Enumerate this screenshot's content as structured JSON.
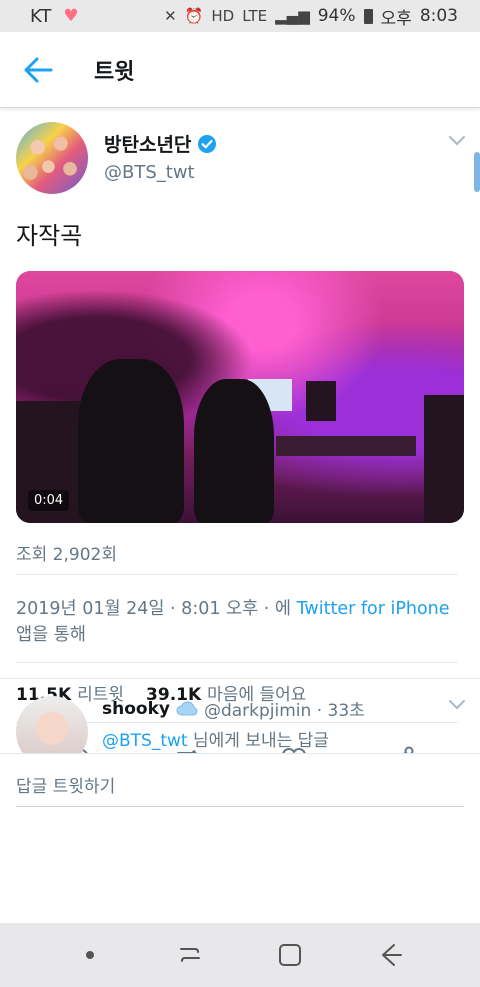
{
  "status_bar": {
    "carrier": "KT",
    "network": "LTE",
    "battery": "94%",
    "ampm": "오후",
    "time": "8:03"
  },
  "header": {
    "title": "트윗"
  },
  "tweet": {
    "display_name": "방탄소년단",
    "handle": "@BTS_twt",
    "text": "자작곡",
    "video_duration": "0:04",
    "views": "조회 2,902회",
    "timestamp": "2019년 01월 24일 · 8:01 오후 · 에",
    "via_link": "Twitter for iPhone",
    "via_suffix": "앱을 통해",
    "retweet_count": "11.5K",
    "retweet_label": "리트윗",
    "like_count": "39.1K",
    "like_label": "마음에 들어요"
  },
  "reply": {
    "name": "shooky",
    "handle": "@darkpjimin · 33초",
    "mention": "@BTS_twt",
    "line": "님에게 보내는 답글"
  },
  "reply_input": {
    "placeholder": "답글 트윗하기"
  },
  "colors": {
    "accent": "#1da1f2",
    "secondary_text": "#657786",
    "primary_text": "#14171a"
  }
}
